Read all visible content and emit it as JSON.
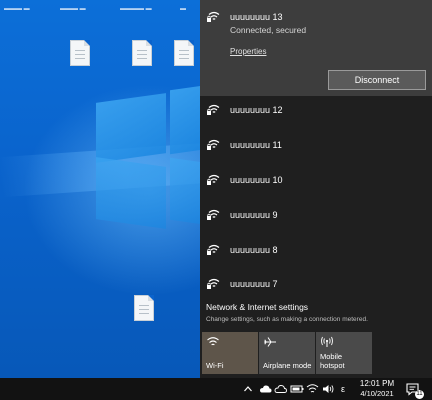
{
  "desktop": {
    "icons": [
      {
        "label": "",
        "icon": "file-icon"
      },
      {
        "label": "",
        "icon": "file-icon"
      },
      {
        "label": "",
        "icon": "file-icon"
      },
      {
        "label": "",
        "icon": "file-icon"
      }
    ]
  },
  "flyout": {
    "connected": {
      "name": "uuuuuuuu 13",
      "status": "Connected, secured",
      "properties_label": "Properties",
      "disconnect_label": "Disconnect",
      "icon": "wifi-secured-icon"
    },
    "networks": [
      {
        "name": "uuuuuuuu 12",
        "icon": "wifi-secured-icon"
      },
      {
        "name": "uuuuuuuu 11",
        "icon": "wifi-secured-icon"
      },
      {
        "name": "uuuuuuuu 10",
        "icon": "wifi-secured-icon"
      },
      {
        "name": "uuuuuuuu 9",
        "icon": "wifi-secured-icon"
      },
      {
        "name": "uuuuuuuu 8",
        "icon": "wifi-secured-icon"
      },
      {
        "name": "uuuuuuuu 7",
        "icon": "wifi-secured-icon"
      }
    ],
    "settings": {
      "title": "Network & Internet settings",
      "description": "Change settings, such as making a connection metered."
    },
    "tiles": {
      "wifi": {
        "label": "Wi-Fi",
        "icon": "wifi-icon",
        "active": true
      },
      "airplane": {
        "label": "Airplane mode",
        "icon": "airplane-icon",
        "active": false
      },
      "hotspot": {
        "label_line1": "Mobile",
        "label_line2": "hotspot",
        "icon": "hotspot-icon",
        "active": false
      }
    }
  },
  "taskbar": {
    "time": "12:01 PM",
    "date": "4/10/2021",
    "language": "ε",
    "notification_count": "11",
    "tray_icons": [
      "chevron-up-icon",
      "cloud-icon",
      "battery-icon",
      "wifi-icon",
      "volume-icon"
    ]
  },
  "colors": {
    "desktop_blue": "#0a63cc",
    "flyout_bg": "#1f1f1f",
    "connected_bg": "#3d3d3d",
    "wifi_tile_active": "#5e554a",
    "tile_bg": "#4a4a4a",
    "taskbar_bg": "#121212"
  }
}
